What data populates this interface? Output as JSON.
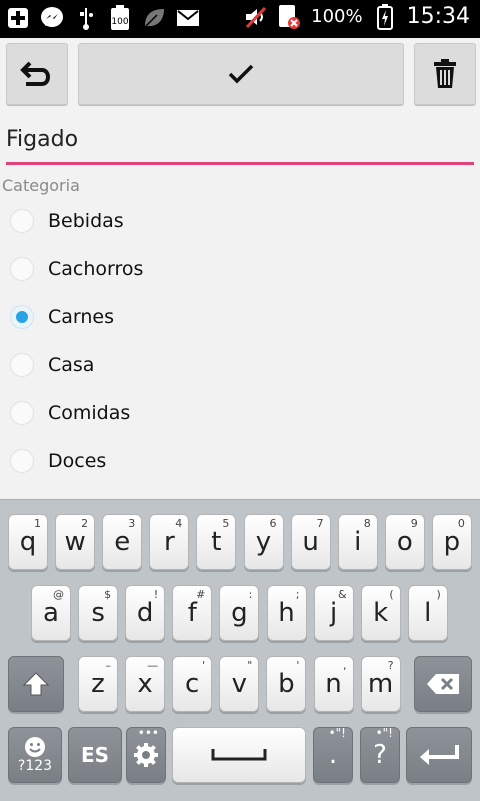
{
  "status_bar": {
    "icons": [
      "plus-icon",
      "messenger-icon",
      "usb-icon",
      "battery-100-icon",
      "leaf-icon",
      "gmail-icon"
    ],
    "right_icons": [
      "volume-mute-icon",
      "sim-error-icon"
    ],
    "battery": "100%",
    "time": "15:34"
  },
  "toolbar": {
    "undo_icon": "undo-icon",
    "ok_icon": "check-icon",
    "delete_icon": "trash-icon"
  },
  "form": {
    "name_value": "Figado",
    "category_label": "Categoria",
    "categories": [
      "Bebidas",
      "Cachorros",
      "Carnes",
      "Casa",
      "Comidas",
      "Doces"
    ],
    "selected": "Carnes",
    "accent": "#e0447c",
    "radio_color": "#2aa3e6"
  },
  "keyboard": {
    "row1": [
      {
        "main": "q",
        "sub": "1"
      },
      {
        "main": "w",
        "sub": "2"
      },
      {
        "main": "e",
        "sub": "3"
      },
      {
        "main": "r",
        "sub": "4"
      },
      {
        "main": "t",
        "sub": "5"
      },
      {
        "main": "y",
        "sub": "6"
      },
      {
        "main": "u",
        "sub": "7"
      },
      {
        "main": "i",
        "sub": "8"
      },
      {
        "main": "o",
        "sub": "9"
      },
      {
        "main": "p",
        "sub": "0"
      }
    ],
    "row2": [
      {
        "main": "a",
        "sub": "@"
      },
      {
        "main": "s",
        "sub": "$"
      },
      {
        "main": "d",
        "sub": "!"
      },
      {
        "main": "f",
        "sub": "#"
      },
      {
        "main": "g",
        "sub": ":"
      },
      {
        "main": "h",
        "sub": ";"
      },
      {
        "main": "j",
        "sub": "&"
      },
      {
        "main": "k",
        "sub": "("
      },
      {
        "main": "l",
        "sub": ")"
      }
    ],
    "row3": [
      {
        "main": "z",
        "sub": "–"
      },
      {
        "main": "x",
        "sub": "—"
      },
      {
        "main": "c",
        "sub": "'"
      },
      {
        "main": "v",
        "sub": "\""
      },
      {
        "main": "b",
        "sub": "'"
      },
      {
        "main": "n",
        "sub": ","
      },
      {
        "main": "m",
        "sub": "?"
      }
    ],
    "emoji_label": "?123",
    "lang_label": "ES",
    "period_label": ".",
    "period_sub": "",
    "question_label": "?",
    "question_sub": "!"
  }
}
